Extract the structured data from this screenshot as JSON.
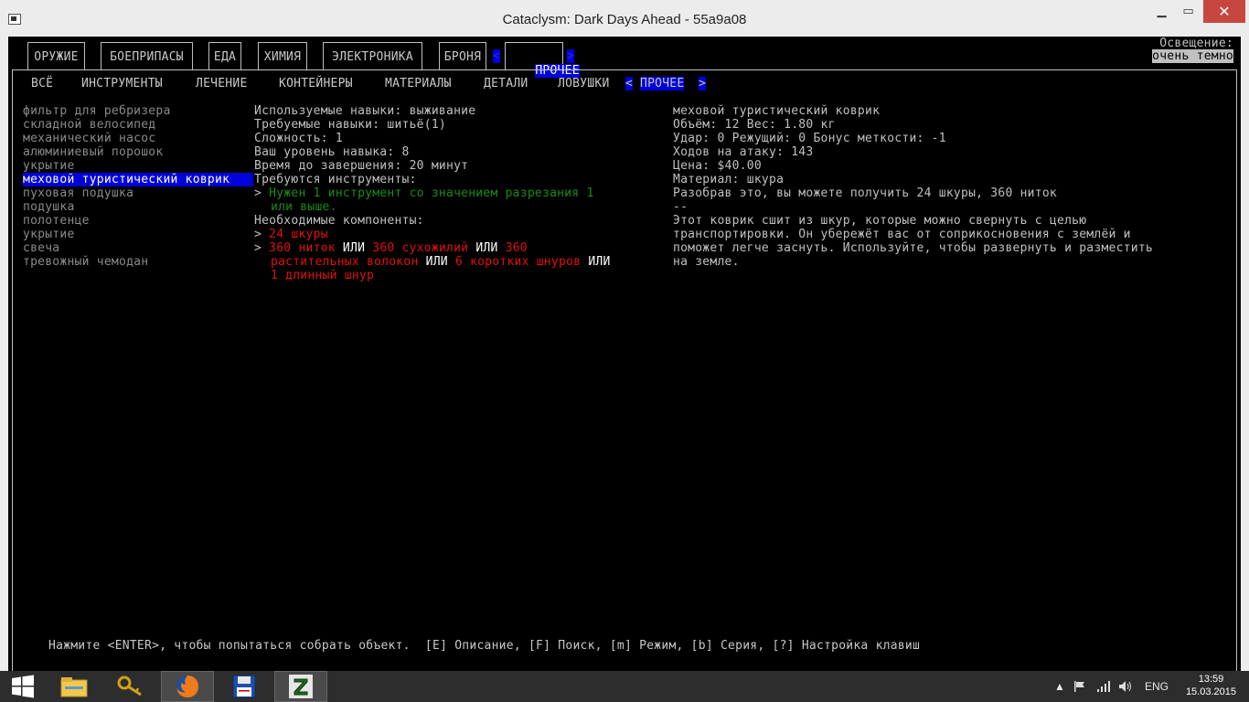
{
  "window": {
    "title": "Cataclysm: Dark Days Ahead - 55a9a08",
    "min_icon": "minimize-icon",
    "max_icon": "maximize-icon",
    "close_icon": "close-icon"
  },
  "tabs": {
    "items": [
      "ОРУЖИЕ",
      "БОЕПРИПАСЫ",
      "ЕДА",
      "ХИМИЯ",
      "ЭЛЕКТРОНИКА",
      "БРОНЯ"
    ],
    "active_left": "<",
    "active": "ПРОЧЕЕ",
    "active_right": ">"
  },
  "lighting": {
    "label": "Освещение:",
    "value": "очень темно"
  },
  "subtabs": {
    "items": [
      "ВСЁ",
      "ИНСТРУМЕНТЫ",
      "ЛЕЧЕНИЕ",
      "КОНТЕЙНЕРЫ",
      "МАТЕРИАЛЫ",
      "ДЕТАЛИ",
      "ЛОВУШКИ"
    ],
    "active_left": "<",
    "active": "ПРОЧЕЕ",
    "active_right": ">"
  },
  "recipes": [
    "фильтр для ребризера",
    "складной велосипед",
    "механический насос",
    "алюминиевый порошок",
    "укрытие",
    "меховой туристический коврик",
    "пуховая подушка",
    "подушка",
    "полотенце",
    "укрытие",
    "свеча",
    "тревожный чемодан"
  ],
  "details": {
    "skills_used": "Используемые навыки: выживание",
    "skills_required": "Требуемые навыки: шитьё(1)",
    "difficulty": "Сложность: 1",
    "your_level": "Ваш уровень навыка: 8",
    "time": "Время до завершения: 20 минут",
    "tools_header": "Требуются инструменты:",
    "tool_bullet": "> ",
    "tool_line1": "Нужен 1 инструмент со значением разрезания 1",
    "tool_line2": "или выше.",
    "components_header": "Необходимые компоненты:",
    "comp1_bullet": "> ",
    "comp1": "24 шкуры",
    "comp2_bullet": "> ",
    "comp2_a": "360 ниток",
    "or1": " ИЛИ ",
    "comp2_b": "360 сухожилий",
    "or2": " ИЛИ ",
    "comp2_c1": "360",
    "comp2_c2": "растительных волокон",
    "or3": " ИЛИ ",
    "comp2_d": "6 коротких шнуров",
    "or4": " ИЛИ",
    "comp2_e": "1 длинный шнур"
  },
  "info": {
    "name": "меховой туристический коврик",
    "volume": "Объём: 12 Вес: 1.80 кг",
    "damage": "Удар: 0 Режущий: 0 Бонус меткости: -1",
    "moves": "Ходов на атаку: 143",
    "price": "Цена: $40.00",
    "material": "Материал: шкура",
    "disassemble": "Разобрав это, вы можете получить 24 шкуры, 360 ниток",
    "sep": "--",
    "desc1": "Этот коврик сшит из шкур, которые можно свернуть с целью",
    "desc2": "транспортировки. Он убережёт вас от соприкосновения с землёй и",
    "desc3": "поможет легче заснуть. Используйте, чтобы развернуть и разместить",
    "desc4": "на земле."
  },
  "footer": "Нажмите <ENTER>, чтобы попытаться собрать объект.  [E] Описание, [F] Поиск, [m] Режим, [b] Серия, [?] Настройка клавиш",
  "taskbar": {
    "apps": [
      "windows-start-icon",
      "file-explorer-icon",
      "keys-icon",
      "firefox-icon",
      "floppy-disk-icon",
      "cataclysm-z-icon"
    ],
    "lang": "ENG",
    "time": "13:59",
    "date": "15.03.2015"
  },
  "colors": {
    "highlight": "#0000d8",
    "tool_ok": "#1a8a1a",
    "missing": "#e01010",
    "close_button": "#c7463f"
  }
}
